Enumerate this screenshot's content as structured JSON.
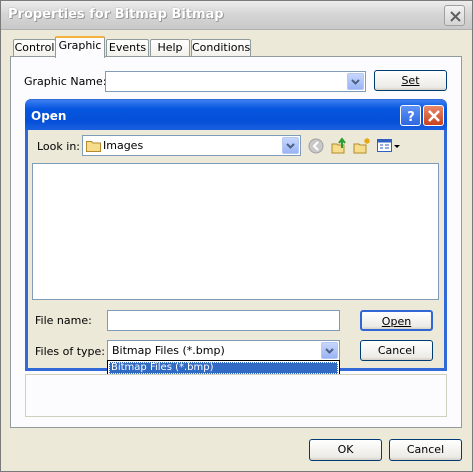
{
  "window": {
    "title": "Properties for Bitmap Bitmap"
  },
  "tabs": [
    {
      "label": "Control",
      "active": false
    },
    {
      "label": "Graphic",
      "active": true
    },
    {
      "label": "Events",
      "active": false
    },
    {
      "label": "Help",
      "active": false
    },
    {
      "label": "Conditions",
      "active": false
    }
  ],
  "graphic": {
    "name_label": "Graphic Name:",
    "name_value": "",
    "set_label": "Set"
  },
  "open_dialog": {
    "title": "Open",
    "look_in_label": "Look in:",
    "look_in_value": "Images",
    "file_name_label": "File name:",
    "file_name_value": "",
    "files_of_type_label": "Files of type:",
    "files_of_type_value": "Bitmap Files (*.bmp)",
    "dropdown_options": [
      "Bitmap Files (*.bmp)"
    ],
    "open_label": "Open",
    "cancel_label": "Cancel"
  },
  "footer": {
    "ok_label": "OK",
    "cancel_label": "Cancel"
  },
  "colors": {
    "accent_blue": "#0550d8",
    "selection": "#316ac5",
    "tab_highlight": "#f3b23c"
  }
}
